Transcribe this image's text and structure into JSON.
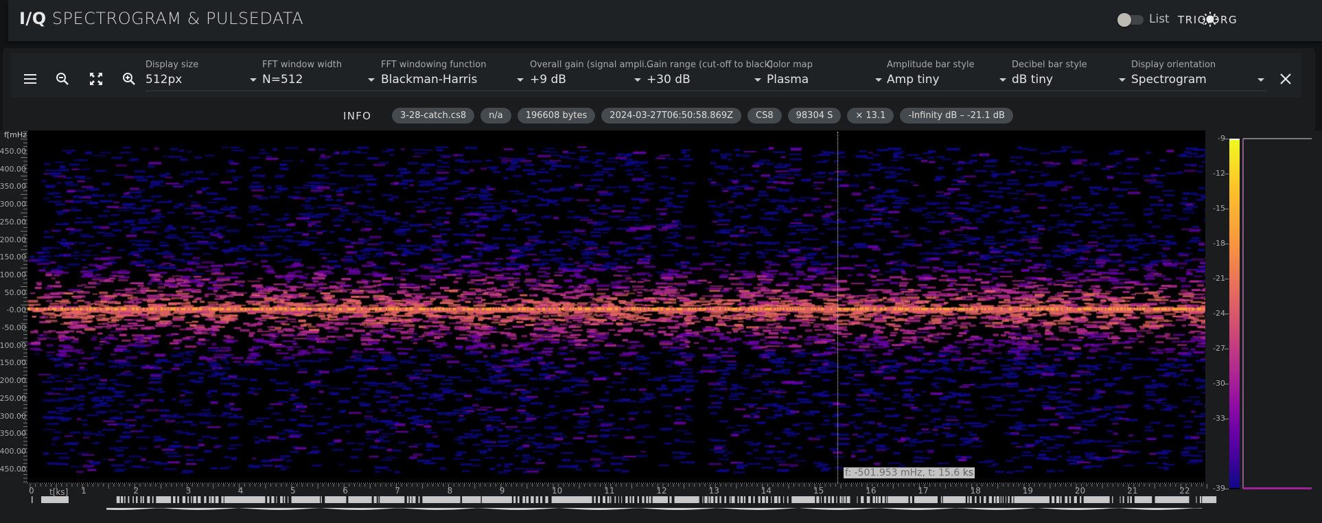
{
  "appbar": {
    "title_strong": "I/Q",
    "title_rest": "SPECTROGRAM & PULSEDATA",
    "list_toggle_label": "List",
    "list_toggle_on": false,
    "theme_icon": "sun-icon",
    "brand": "TRIQ.ORG"
  },
  "toolbar": {
    "icons": [
      "menu-icon",
      "zoom-out-icon",
      "fullscreen-icon",
      "zoom-in-icon"
    ],
    "fields": [
      {
        "label": "Display size",
        "value": "512px"
      },
      {
        "label": "FFT window width",
        "value": "N=512"
      },
      {
        "label": "FFT windowing function",
        "value": "Blackman-Harris"
      },
      {
        "label": "Overall gain (signal ampli...",
        "value": "+9 dB"
      },
      {
        "label": "Gain range (cut-off to black)",
        "value": "+30 dB"
      },
      {
        "label": "Color map",
        "value": "Plasma"
      },
      {
        "label": "Amplitude bar style",
        "value": "Amp tiny"
      },
      {
        "label": "Decibel bar style",
        "value": "dB tiny"
      },
      {
        "label": "Display orientation",
        "value": "Spectrogram"
      }
    ],
    "close_icon": "close-icon"
  },
  "info": {
    "label": "INFO",
    "chips": [
      "3-28-catch.cs8",
      "n/a",
      "196608 bytes",
      "2024-03-27T06:50:58.869Z",
      "CS8",
      "98304 S",
      "× 13.1",
      "-Infinity dB – -21.1 dB"
    ]
  },
  "spectrogram": {
    "y_axis_label": "f[mHz]",
    "y_ticks": [
      "450.00",
      "400.00",
      "350.00",
      "300.00",
      "250.00",
      "200.00",
      "150.00",
      "100.00",
      "50.00",
      "-0.00",
      "-50.00",
      "-100.00",
      "-150.00",
      "-200.00",
      "-250.00",
      "-300.00",
      "-350.00",
      "-400.00",
      "-450.00"
    ],
    "x_axis_label": "t[ks]",
    "x_ticks": [
      "0",
      "1",
      "2",
      "3",
      "4",
      "5",
      "6",
      "7",
      "8",
      "9",
      "10",
      "11",
      "12",
      "13",
      "14",
      "15",
      "16",
      "17",
      "18",
      "19",
      "20",
      "21",
      "22"
    ],
    "cursor_readout": "f: -501.953 mHz, t: 15.6 ",
    "cursor_readout_unit": "ks",
    "colormap": [
      "#0d0887",
      "#6a00a8",
      "#b12a90",
      "#e16462",
      "#fca636",
      "#f0f921"
    ]
  },
  "colorbar": {
    "ticks": [
      "-9",
      "-12",
      "-15",
      "-18",
      "-21",
      "-24",
      "-27",
      "-30",
      "-33",
      "-39"
    ],
    "range_db": [
      -39,
      -9
    ]
  }
}
